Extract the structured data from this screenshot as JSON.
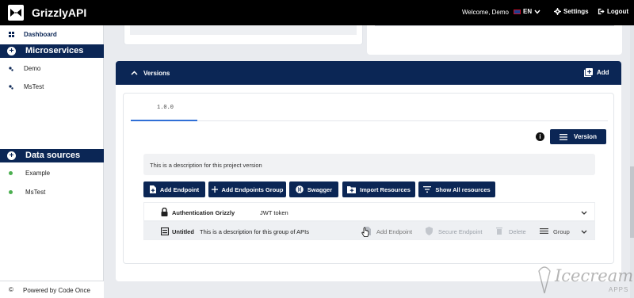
{
  "app": {
    "title": "GrizzlyAPI"
  },
  "topbar": {
    "welcome": "Welcome, Demo",
    "language": "EN",
    "settings_label": "Settings",
    "logout_label": "Logout"
  },
  "sidebar": {
    "dashboard_label": "Dashboard",
    "microservices_header": "Microservices",
    "microservices": [
      {
        "label": "Demo"
      },
      {
        "label": "MsTest"
      }
    ],
    "datasources_header": "Data sources",
    "datasources": [
      {
        "label": "Example"
      },
      {
        "label": "MsTest"
      }
    ],
    "footer": "Powered by Code Once"
  },
  "versions": {
    "header": "Versions",
    "add_label": "Add",
    "tabs": [
      {
        "label": "1.0.0"
      }
    ],
    "version_button": "Version",
    "description": "This is a description for this project version",
    "actions": [
      {
        "label": "Add Endpoint",
        "icon": "file-plus-icon"
      },
      {
        "label": "Add Endpoints Group",
        "icon": "plus-icon"
      },
      {
        "label": "Swagger",
        "icon": "swagger-icon"
      },
      {
        "label": "Import Resources",
        "icon": "folder-plus-icon"
      },
      {
        "label": "Show All resources",
        "icon": "filter-icon"
      }
    ],
    "groups": [
      {
        "name": "Authentication Grizzly",
        "detail": "JWT token",
        "icon": "lock-icon"
      },
      {
        "name": "Untitled",
        "detail": "This is a description for this group of APIs",
        "icon": "group-icon",
        "row_actions": {
          "add_endpoint": "Add Endpoint",
          "secure_endpoint": "Secure Endpoint",
          "delete": "Delete",
          "group": "Group"
        }
      }
    ]
  },
  "watermark": {
    "line1": "Icecream",
    "line2": "APPS"
  },
  "colors": {
    "primary": "#0b2655",
    "topbar": "#000000",
    "accent": "#2f6fd6",
    "status_green": "#4caf50"
  }
}
